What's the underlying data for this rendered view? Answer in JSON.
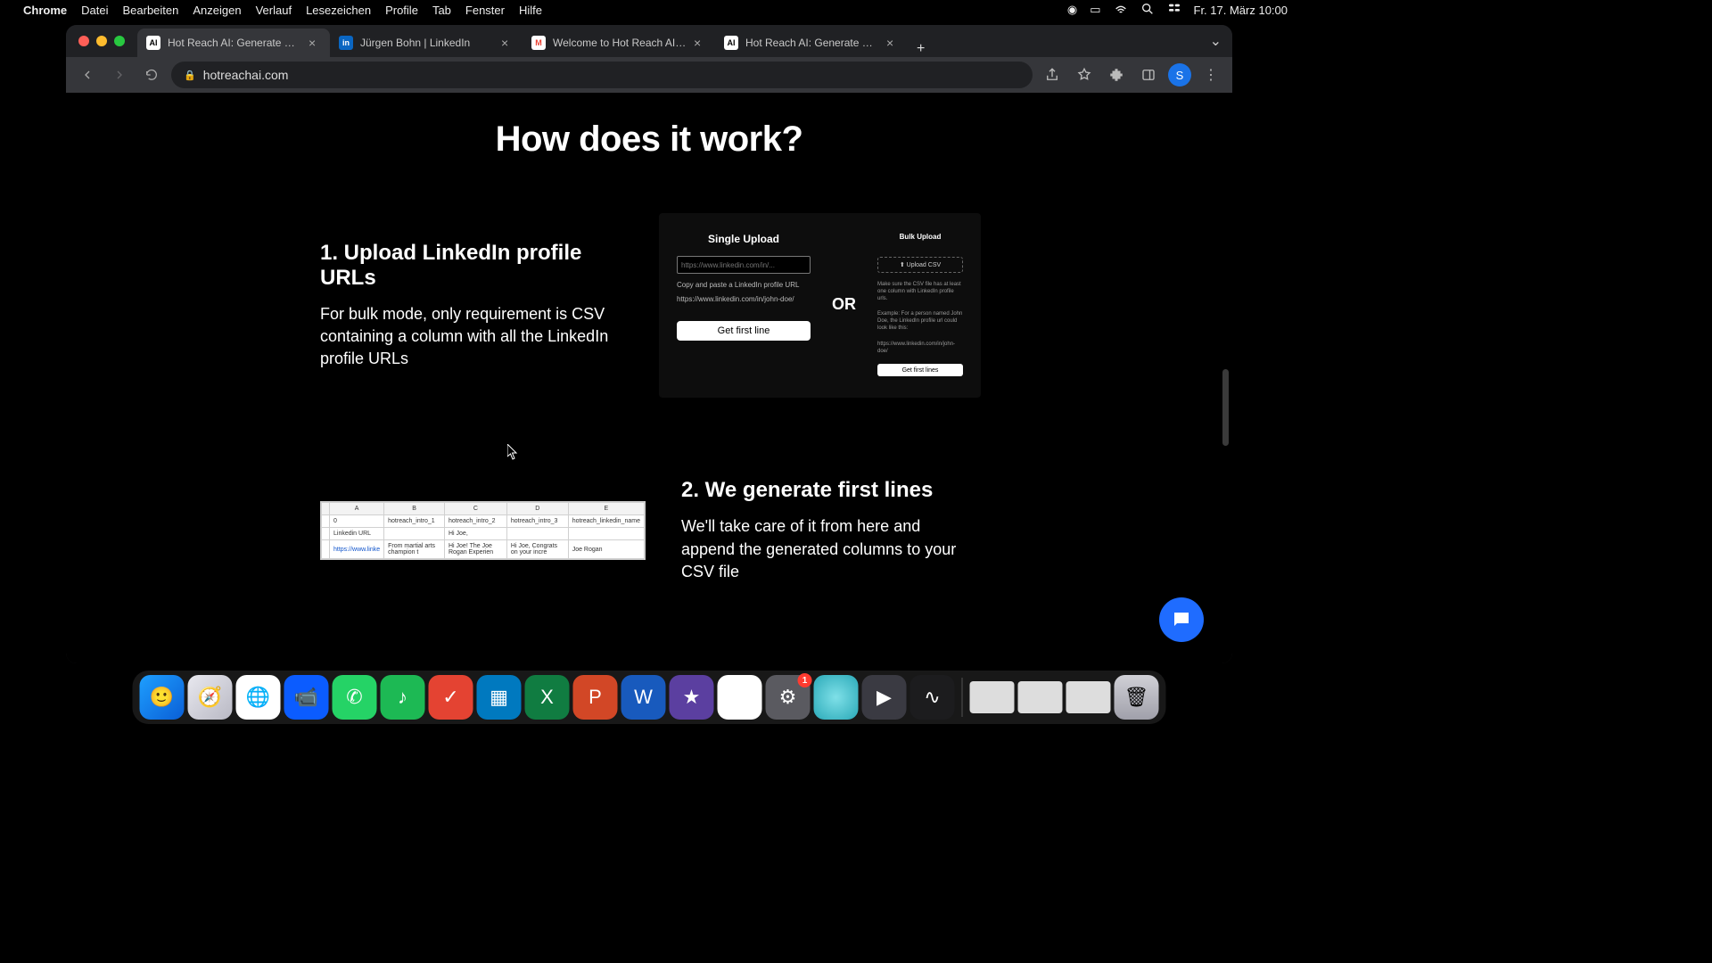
{
  "menubar": {
    "app": "Chrome",
    "items": [
      "Datei",
      "Bearbeiten",
      "Anzeigen",
      "Verlauf",
      "Lesezeichen",
      "Profile",
      "Tab",
      "Fenster",
      "Hilfe"
    ],
    "clock": "Fr. 17. März  10:00"
  },
  "tabs": [
    {
      "title": "Hot Reach AI: Generate First L",
      "fav": "AI",
      "active": true
    },
    {
      "title": "Jürgen Bohn | LinkedIn",
      "fav": "in",
      "active": false
    },
    {
      "title": "Welcome to Hot Reach AI - sa",
      "fav": "M",
      "active": false
    },
    {
      "title": "Hot Reach AI: Generate First L",
      "fav": "AI",
      "active": false
    }
  ],
  "address": "hotreachai.com",
  "avatar": "S",
  "page": {
    "heading": "How does it work?",
    "step1": {
      "title": "1. Upload LinkedIn profile URLs",
      "body": "For bulk mode, only requirement is CSV containing a column with all the LinkedIn profile URLs"
    },
    "upload": {
      "single_title": "Single Upload",
      "placeholder": "https://www.linkedin.com/in/...",
      "hint": "Copy and paste a LinkedIn profile URL",
      "example": "https://www.linkedin.com/in/john-doe/",
      "button": "Get first line",
      "or": "OR",
      "bulk_title": "Bulk Upload",
      "bulk_drop": "⬆ Upload CSV",
      "bulk_note1": "Make sure the CSV file has at least one column with LinkedIn profile urls.",
      "bulk_note2": "Example: For a person named John Doe, the LinkedIn profile url could look like this:",
      "bulk_note3": "https://www.linkedin.com/in/john-doe/",
      "bulk_button": "Get first lines"
    },
    "step2": {
      "title": "2. We generate first lines",
      "body": "We'll take care of it from here and append the generated columns to your CSV file"
    },
    "sheet": {
      "cols": [
        "",
        "A",
        "B",
        "C",
        "D",
        "E"
      ],
      "headers": [
        "",
        "0",
        "hotreach_intro_1",
        "hotreach_intro_2",
        "hotreach_intro_3",
        "hotreach_linkedin_name"
      ],
      "row_label": [
        "",
        "Linkedin URL",
        "",
        "Hi Joe,",
        "",
        ""
      ],
      "row_data": [
        "",
        "https://www.linke",
        "From martial arts champion t",
        "Hi Joe! The Joe Rogan Experien",
        "Hi Joe, Congrats on your incre",
        "Joe Rogan"
      ]
    }
  },
  "dock": {
    "apps": [
      {
        "name": "finder",
        "bg": "linear-gradient(135deg,#1e9fff,#0a5fd6)",
        "glyph": "🙂"
      },
      {
        "name": "safari",
        "bg": "linear-gradient(135deg,#e8e8ef,#b9b9c4)",
        "glyph": "🧭"
      },
      {
        "name": "chrome",
        "bg": "#fff",
        "glyph": "🌐"
      },
      {
        "name": "zoom",
        "bg": "#0b5cff",
        "glyph": "📹"
      },
      {
        "name": "whatsapp",
        "bg": "#25d366",
        "glyph": "✆"
      },
      {
        "name": "spotify",
        "bg": "#1db954",
        "glyph": "♪"
      },
      {
        "name": "todoist",
        "bg": "#e44332",
        "glyph": "✓"
      },
      {
        "name": "trello",
        "bg": "#0079bf",
        "glyph": "▦"
      },
      {
        "name": "excel",
        "bg": "#107c41",
        "glyph": "X"
      },
      {
        "name": "powerpoint",
        "bg": "#d24726",
        "glyph": "P"
      },
      {
        "name": "word",
        "bg": "#185abd",
        "glyph": "W"
      },
      {
        "name": "imovie",
        "bg": "#5b3fa0",
        "glyph": "★"
      },
      {
        "name": "drive",
        "bg": "#fff",
        "glyph": "▲"
      },
      {
        "name": "settings",
        "bg": "#5a5a60",
        "glyph": "⚙",
        "badge": "1"
      },
      {
        "name": "app",
        "bg": "radial-gradient(circle,#7fe0e8,#2aa9b8)",
        "glyph": ""
      },
      {
        "name": "quicktime",
        "bg": "#3a3a42",
        "glyph": "▶"
      },
      {
        "name": "voicememos",
        "bg": "#1c1c1e",
        "glyph": "∿"
      }
    ],
    "trash": "🗑"
  }
}
